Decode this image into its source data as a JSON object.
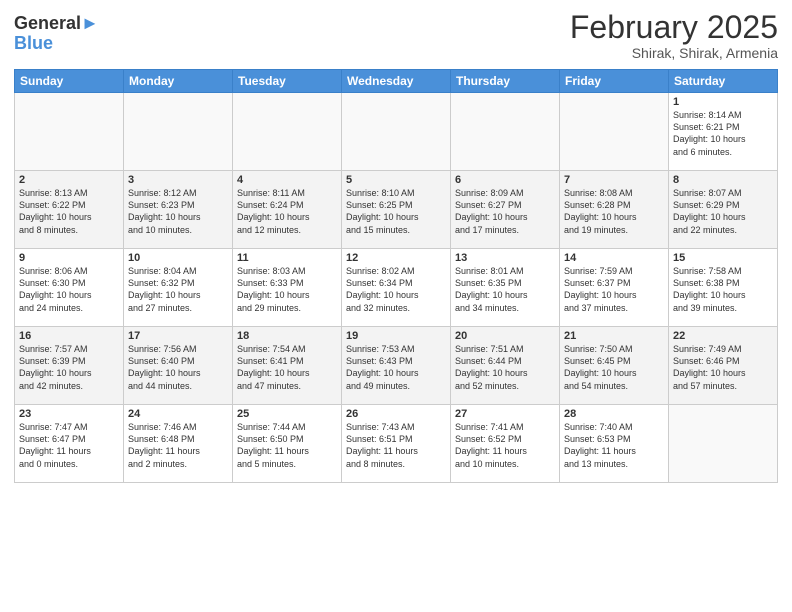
{
  "header": {
    "logo_line1": "General",
    "logo_line2": "Blue",
    "month": "February 2025",
    "location": "Shirak, Shirak, Armenia"
  },
  "weekdays": [
    "Sunday",
    "Monday",
    "Tuesday",
    "Wednesday",
    "Thursday",
    "Friday",
    "Saturday"
  ],
  "weeks": [
    [
      {
        "day": "",
        "info": ""
      },
      {
        "day": "",
        "info": ""
      },
      {
        "day": "",
        "info": ""
      },
      {
        "day": "",
        "info": ""
      },
      {
        "day": "",
        "info": ""
      },
      {
        "day": "",
        "info": ""
      },
      {
        "day": "1",
        "info": "Sunrise: 8:14 AM\nSunset: 6:21 PM\nDaylight: 10 hours\nand 6 minutes."
      }
    ],
    [
      {
        "day": "2",
        "info": "Sunrise: 8:13 AM\nSunset: 6:22 PM\nDaylight: 10 hours\nand 8 minutes."
      },
      {
        "day": "3",
        "info": "Sunrise: 8:12 AM\nSunset: 6:23 PM\nDaylight: 10 hours\nand 10 minutes."
      },
      {
        "day": "4",
        "info": "Sunrise: 8:11 AM\nSunset: 6:24 PM\nDaylight: 10 hours\nand 12 minutes."
      },
      {
        "day": "5",
        "info": "Sunrise: 8:10 AM\nSunset: 6:25 PM\nDaylight: 10 hours\nand 15 minutes."
      },
      {
        "day": "6",
        "info": "Sunrise: 8:09 AM\nSunset: 6:27 PM\nDaylight: 10 hours\nand 17 minutes."
      },
      {
        "day": "7",
        "info": "Sunrise: 8:08 AM\nSunset: 6:28 PM\nDaylight: 10 hours\nand 19 minutes."
      },
      {
        "day": "8",
        "info": "Sunrise: 8:07 AM\nSunset: 6:29 PM\nDaylight: 10 hours\nand 22 minutes."
      }
    ],
    [
      {
        "day": "9",
        "info": "Sunrise: 8:06 AM\nSunset: 6:30 PM\nDaylight: 10 hours\nand 24 minutes."
      },
      {
        "day": "10",
        "info": "Sunrise: 8:04 AM\nSunset: 6:32 PM\nDaylight: 10 hours\nand 27 minutes."
      },
      {
        "day": "11",
        "info": "Sunrise: 8:03 AM\nSunset: 6:33 PM\nDaylight: 10 hours\nand 29 minutes."
      },
      {
        "day": "12",
        "info": "Sunrise: 8:02 AM\nSunset: 6:34 PM\nDaylight: 10 hours\nand 32 minutes."
      },
      {
        "day": "13",
        "info": "Sunrise: 8:01 AM\nSunset: 6:35 PM\nDaylight: 10 hours\nand 34 minutes."
      },
      {
        "day": "14",
        "info": "Sunrise: 7:59 AM\nSunset: 6:37 PM\nDaylight: 10 hours\nand 37 minutes."
      },
      {
        "day": "15",
        "info": "Sunrise: 7:58 AM\nSunset: 6:38 PM\nDaylight: 10 hours\nand 39 minutes."
      }
    ],
    [
      {
        "day": "16",
        "info": "Sunrise: 7:57 AM\nSunset: 6:39 PM\nDaylight: 10 hours\nand 42 minutes."
      },
      {
        "day": "17",
        "info": "Sunrise: 7:56 AM\nSunset: 6:40 PM\nDaylight: 10 hours\nand 44 minutes."
      },
      {
        "day": "18",
        "info": "Sunrise: 7:54 AM\nSunset: 6:41 PM\nDaylight: 10 hours\nand 47 minutes."
      },
      {
        "day": "19",
        "info": "Sunrise: 7:53 AM\nSunset: 6:43 PM\nDaylight: 10 hours\nand 49 minutes."
      },
      {
        "day": "20",
        "info": "Sunrise: 7:51 AM\nSunset: 6:44 PM\nDaylight: 10 hours\nand 52 minutes."
      },
      {
        "day": "21",
        "info": "Sunrise: 7:50 AM\nSunset: 6:45 PM\nDaylight: 10 hours\nand 54 minutes."
      },
      {
        "day": "22",
        "info": "Sunrise: 7:49 AM\nSunset: 6:46 PM\nDaylight: 10 hours\nand 57 minutes."
      }
    ],
    [
      {
        "day": "23",
        "info": "Sunrise: 7:47 AM\nSunset: 6:47 PM\nDaylight: 11 hours\nand 0 minutes."
      },
      {
        "day": "24",
        "info": "Sunrise: 7:46 AM\nSunset: 6:48 PM\nDaylight: 11 hours\nand 2 minutes."
      },
      {
        "day": "25",
        "info": "Sunrise: 7:44 AM\nSunset: 6:50 PM\nDaylight: 11 hours\nand 5 minutes."
      },
      {
        "day": "26",
        "info": "Sunrise: 7:43 AM\nSunset: 6:51 PM\nDaylight: 11 hours\nand 8 minutes."
      },
      {
        "day": "27",
        "info": "Sunrise: 7:41 AM\nSunset: 6:52 PM\nDaylight: 11 hours\nand 10 minutes."
      },
      {
        "day": "28",
        "info": "Sunrise: 7:40 AM\nSunset: 6:53 PM\nDaylight: 11 hours\nand 13 minutes."
      },
      {
        "day": "",
        "info": ""
      }
    ]
  ]
}
